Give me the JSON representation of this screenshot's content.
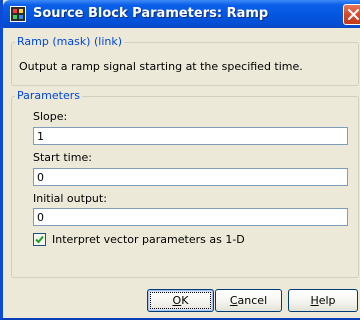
{
  "window": {
    "title": "Source Block Parameters: Ramp"
  },
  "description_group": {
    "legend": "Ramp (mask) (link)",
    "text": "Output a ramp signal starting at the specified time."
  },
  "parameters_group": {
    "legend": "Parameters",
    "slope": {
      "label": "Slope:",
      "value": "1"
    },
    "start_time": {
      "label": "Start time:",
      "value": "0"
    },
    "initial_output": {
      "label": "Initial output:",
      "value": "0"
    },
    "interpret_checkbox": {
      "label": "Interpret vector parameters as 1-D",
      "checked": true
    }
  },
  "buttons": {
    "ok": {
      "mnemonic": "O",
      "rest": "K"
    },
    "cancel": {
      "mnemonic": "C",
      "rest": "ancel"
    },
    "help": {
      "mnemonic": "H",
      "rest": "elp"
    }
  },
  "colors": {
    "titlebar": "#0457e0",
    "group_label": "#0046d5",
    "dialog_bg": "#ece9d8"
  },
  "icons": [
    "app-icon",
    "close-icon",
    "checkmark-icon"
  ]
}
